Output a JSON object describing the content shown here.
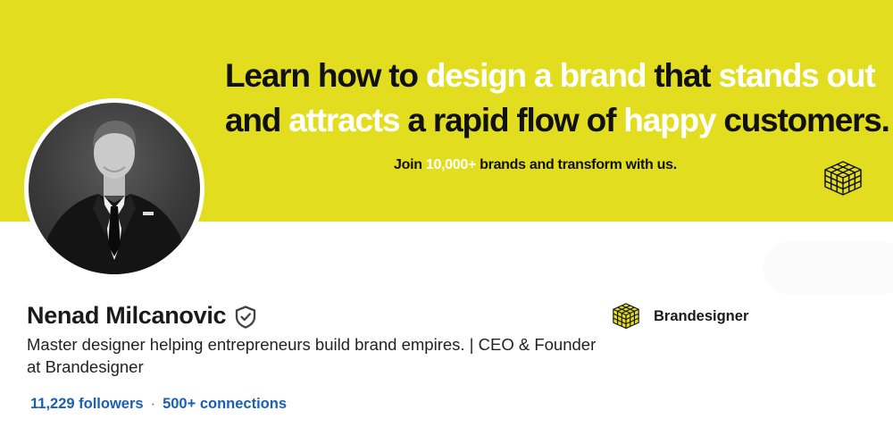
{
  "banner": {
    "headline_line1": [
      {
        "text": "Learn how to ",
        "highlight": false
      },
      {
        "text": "design a brand",
        "highlight": true
      },
      {
        "text": " that ",
        "highlight": false
      },
      {
        "text": "stands out",
        "highlight": true
      }
    ],
    "headline_line2": [
      {
        "text": "and ",
        "highlight": false
      },
      {
        "text": "attracts",
        "highlight": true
      },
      {
        "text": " a rapid flow of ",
        "highlight": false
      },
      {
        "text": "happy",
        "highlight": true
      },
      {
        "text": " customers.",
        "highlight": false
      }
    ],
    "subline": [
      {
        "text": "Join ",
        "highlight": false
      },
      {
        "text": "10,000+",
        "highlight": true
      },
      {
        "text": " brands and transform with us.",
        "highlight": false
      }
    ],
    "logo_icon": "cube-grid-icon",
    "background_color": "#e2de1f"
  },
  "profile": {
    "name": "Nenad Milcanovic",
    "verified_icon": "verified-shield-icon",
    "headline": "Master designer helping entrepreneurs build brand empires. | CEO & Founder at Brandesigner",
    "followers": "11,229 followers",
    "separator": "·",
    "connections": "500+ connections",
    "avatar_icon": "profile-photo"
  },
  "company": {
    "name": "Brandesigner",
    "logo_icon": "cube-grid-icon"
  },
  "colors": {
    "accent_link": "#1a5fb4",
    "banner_yellow": "#e2de1f"
  }
}
